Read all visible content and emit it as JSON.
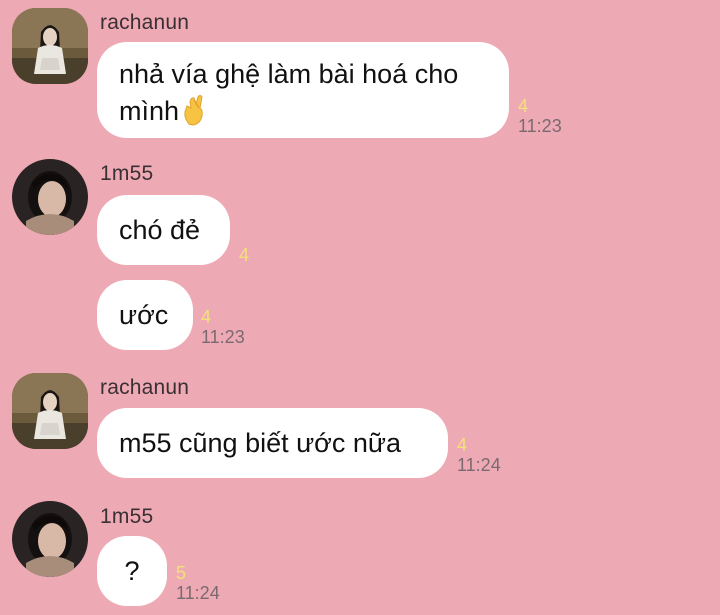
{
  "messages": [
    {
      "sender": "rachanun",
      "bubbles": [
        {
          "text": "nhả vía ghệ làm bài hoá cho mình",
          "emoji": "crossed-fingers",
          "read_count": "4",
          "time": "11:23"
        }
      ]
    },
    {
      "sender": "1m55",
      "bubbles": [
        {
          "text": "chó đẻ",
          "read_count": "4",
          "time": ""
        },
        {
          "text": "ước",
          "read_count": "4",
          "time": "11:23"
        }
      ]
    },
    {
      "sender": "rachanun",
      "bubbles": [
        {
          "text": "m55 cũng biết ước nữa",
          "read_count": "4",
          "time": "11:24"
        }
      ]
    },
    {
      "sender": "1m55",
      "bubbles": [
        {
          "text": "?",
          "read_count": "5",
          "time": "11:24"
        }
      ]
    }
  ],
  "colors": {
    "background": "#eeaab4",
    "bubble": "#ffffff",
    "read_count": "#f4e07a",
    "timestamp": "#7a6a70"
  },
  "icons": {
    "emoji": "crossed-fingers-emoji",
    "avatar_rachanun": "profile-photo",
    "avatar_1m55": "profile-photo"
  }
}
